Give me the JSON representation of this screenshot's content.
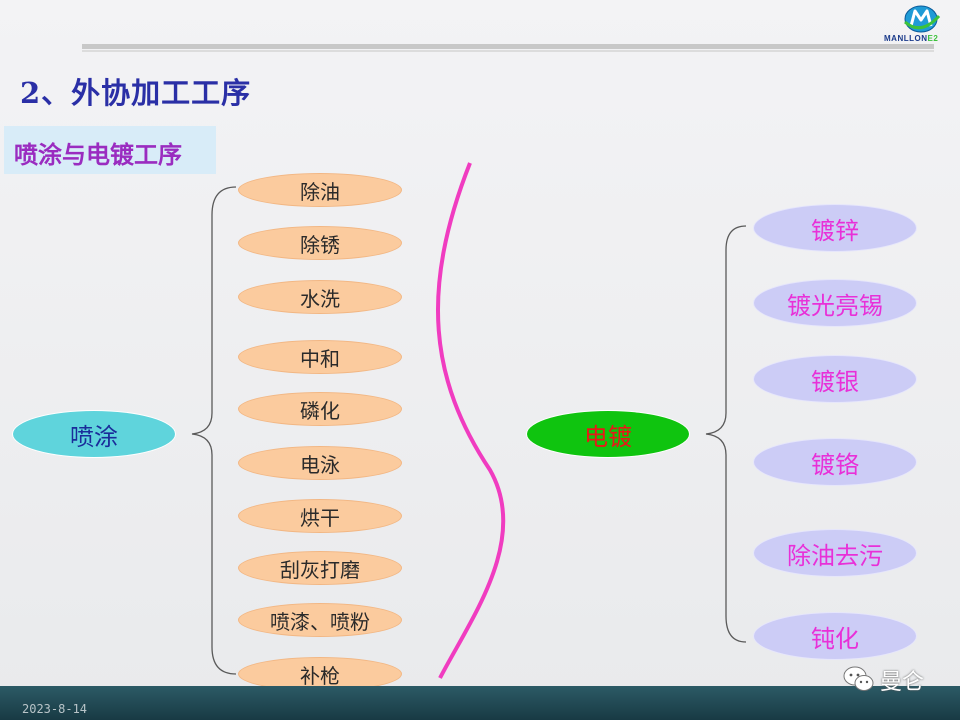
{
  "header": {
    "title": "2、外协加工工序"
  },
  "logo": {
    "text": "MANLLON",
    "suffix": "E2"
  },
  "section": {
    "label": "喷涂与电镀工序"
  },
  "spray": {
    "label": "喷涂",
    "steps": [
      "除油",
      "除锈",
      "水洗",
      "中和",
      "磷化",
      "电泳",
      "烘干",
      "刮灰打磨",
      "喷漆、喷粉",
      "补枪"
    ]
  },
  "plating": {
    "label": "电镀",
    "items": [
      "镀锌",
      "镀光亮锡",
      "镀银",
      "镀铬",
      "除油去污",
      "钝化"
    ]
  },
  "footer": {
    "date": "2023-8-14"
  },
  "watermark": {
    "text": "曼仑"
  },
  "colors": {
    "title": "#2a2fa6",
    "section_label": "#9a2cc0",
    "step_fill": "#fbcb9e",
    "spray_fill": "#5fd4dc",
    "spray_text": "#1a2c9a",
    "plating_main_fill": "#0fc40f",
    "plating_main_text": "#e81818",
    "plating_item_fill": "#ccccf6",
    "plating_item_text": "#e830d8",
    "divider_curve": "#f03cc0"
  }
}
